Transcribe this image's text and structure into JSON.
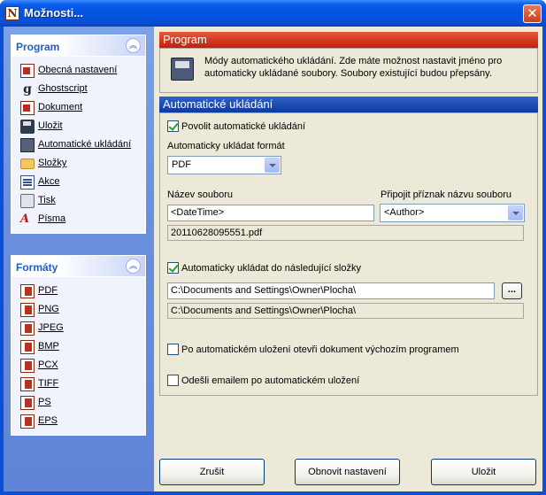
{
  "window": {
    "title": "Možnosti..."
  },
  "sidebar": {
    "program_panel": {
      "title": "Program",
      "items": [
        {
          "label": "Obecná nastavení",
          "icon": "document-settings-icon"
        },
        {
          "label": "Ghostscript",
          "icon": "ghostscript-icon"
        },
        {
          "label": "Dokument",
          "icon": "document-icon"
        },
        {
          "label": "Uložit",
          "icon": "floppy-disk-icon"
        },
        {
          "label": "Automatické ukládání",
          "icon": "auto-save-icon"
        },
        {
          "label": "Složky",
          "icon": "folder-icon"
        },
        {
          "label": "Akce",
          "icon": "actions-icon"
        },
        {
          "label": "Tisk",
          "icon": "printer-icon"
        },
        {
          "label": "Písma",
          "icon": "fonts-icon"
        }
      ]
    },
    "formats_panel": {
      "title": "Formáty",
      "items": [
        {
          "label": "PDF",
          "icon": "pdf-format-icon"
        },
        {
          "label": "PNG",
          "icon": "png-format-icon"
        },
        {
          "label": "JPEG",
          "icon": "jpeg-format-icon"
        },
        {
          "label": "BMP",
          "icon": "bmp-format-icon"
        },
        {
          "label": "PCX",
          "icon": "pcx-format-icon"
        },
        {
          "label": "TIFF",
          "icon": "tiff-format-icon"
        },
        {
          "label": "PS",
          "icon": "ps-format-icon"
        },
        {
          "label": "EPS",
          "icon": "eps-format-icon"
        }
      ]
    }
  },
  "program_section": {
    "title": "Program",
    "description": "Módy automatického ukládání. Zde máte možnost nastavit jméno pro automaticky ukládané soubory. Soubory existující budou přepsány."
  },
  "autosave_section": {
    "title": "Automatické ukládání",
    "enable_label": "Povolit automatické ukládání",
    "enable_checked": true,
    "format_label": "Automaticky ukládat formát",
    "format_value": "PDF",
    "filename_label": "Název souboru",
    "filename_value": "<DateTime>",
    "token_label": "Připojit příznak názvu souboru",
    "token_value": "<Author>",
    "filename_preview": "20110628095551.pdf",
    "folder_checkbox_label": "Automaticky ukládat do následující složky",
    "folder_checked": true,
    "folder_value": "C:\\Documents and Settings\\Owner\\Plocha\\",
    "browse_label": "...",
    "folder_preview": "C:\\Documents and Settings\\Owner\\Plocha\\",
    "open_default_label": "Po automatickém uložení otevři dokument výchozím programem",
    "open_default_checked": false,
    "email_label": "Odešli emailem po automatickém uložení",
    "email_checked": false
  },
  "buttons": {
    "cancel": "Zrušit",
    "reset": "Obnovit nastavení",
    "save": "Uložit"
  },
  "colors": {
    "title_blue": "#0353e0",
    "section_red": "#c21f0f",
    "section_blue": "#0b3a9e"
  }
}
